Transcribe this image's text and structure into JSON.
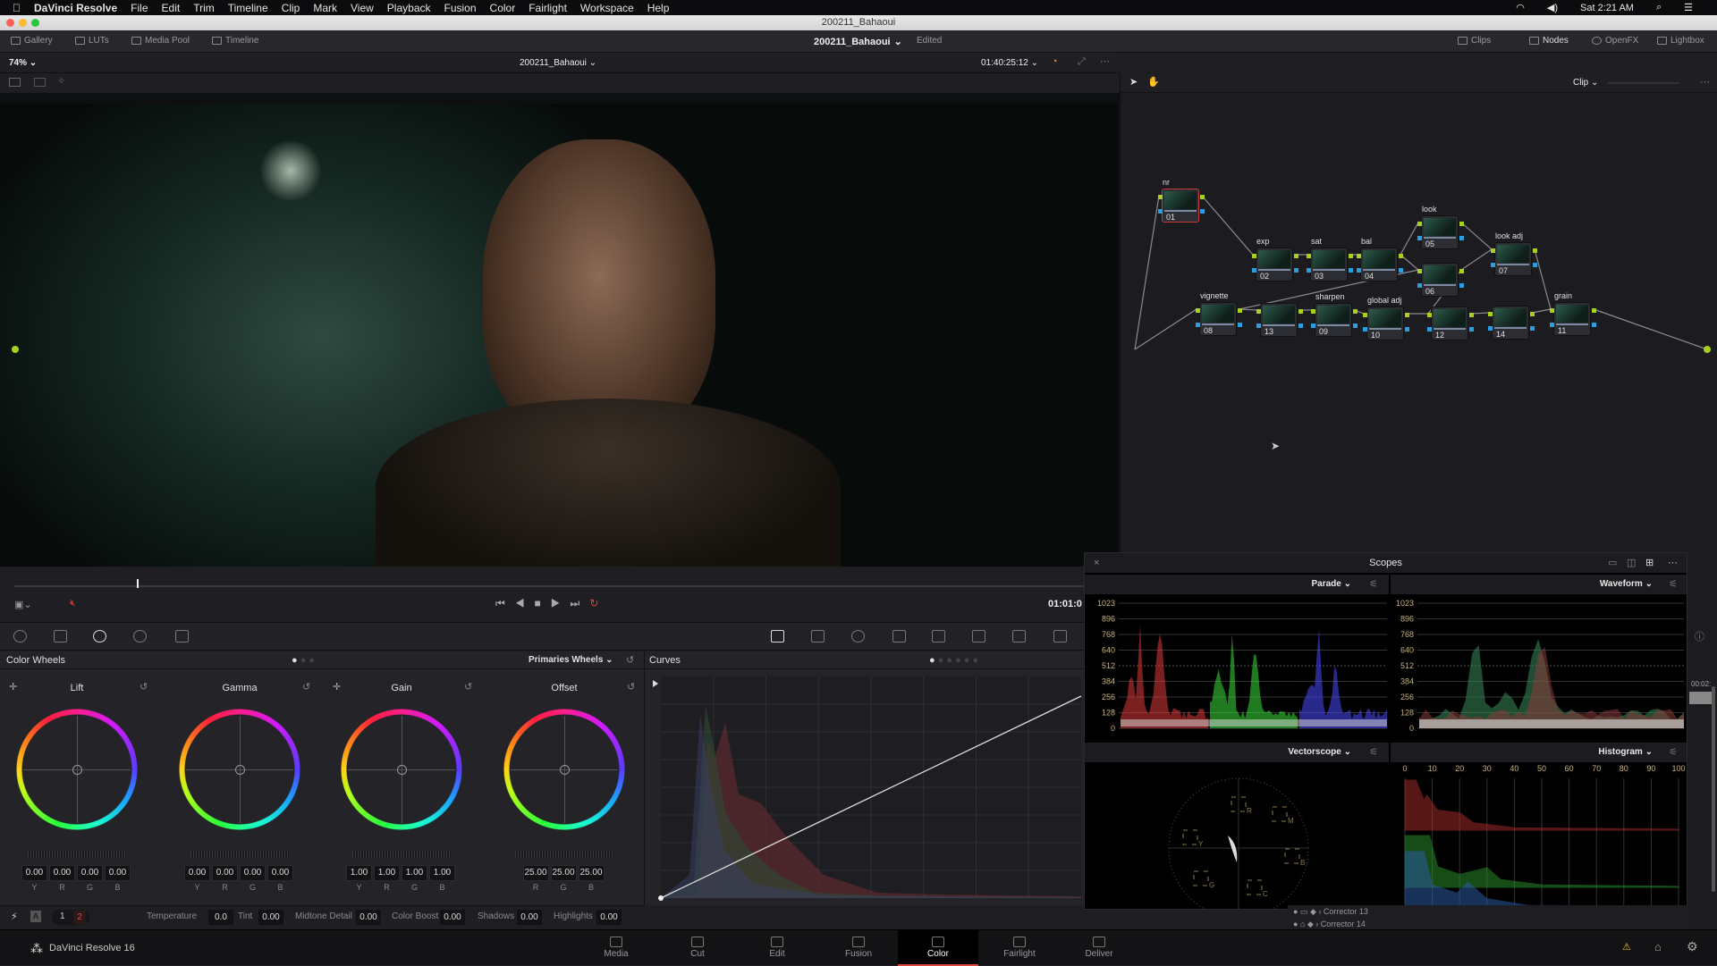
{
  "menubar": {
    "app": "DaVinci Resolve",
    "items": [
      "File",
      "Edit",
      "Trim",
      "Timeline",
      "Clip",
      "Mark",
      "View",
      "Playback",
      "Fusion",
      "Color",
      "Fairlight",
      "Workspace",
      "Help"
    ],
    "clock": "Sat 2:21 AM"
  },
  "window": {
    "title": "200211_Bahaoui"
  },
  "toolbar": {
    "left": [
      "Gallery",
      "LUTs",
      "Media Pool",
      "Timeline"
    ],
    "project": "200211_Bahaoui",
    "status": "Edited",
    "right": [
      "Clips",
      "Nodes",
      "OpenFX",
      "Lightbox"
    ]
  },
  "viewer": {
    "zoom": "74%",
    "clip": "200211_Bahaoui",
    "timecode": "01:40:25:12",
    "node_mode": "Clip",
    "playhead_timecode": "01:01:0"
  },
  "nodes": [
    {
      "label": "nr",
      "num": "01"
    },
    {
      "label": "exp",
      "num": "02"
    },
    {
      "label": "sat",
      "num": "03"
    },
    {
      "label": "bal",
      "num": "04"
    },
    {
      "label": "look",
      "num": "05"
    },
    {
      "label": "",
      "num": "06"
    },
    {
      "label": "look adj",
      "num": "07"
    },
    {
      "label": "vignette",
      "num": "08"
    },
    {
      "label": "",
      "num": "13"
    },
    {
      "label": "sharpen",
      "num": "09"
    },
    {
      "label": "global adj",
      "num": "10"
    },
    {
      "label": "",
      "num": "12"
    },
    {
      "label": "",
      "num": "14"
    },
    {
      "label": "grain",
      "num": "11"
    }
  ],
  "color_wheels": {
    "title": "Color Wheels",
    "mode": "Primaries Wheels",
    "wheels": [
      {
        "name": "Lift",
        "values": [
          "0.00",
          "0.00",
          "0.00",
          "0.00"
        ],
        "channels": [
          "Y",
          "R",
          "G",
          "B"
        ]
      },
      {
        "name": "Gamma",
        "values": [
          "0.00",
          "0.00",
          "0.00",
          "0.00"
        ],
        "channels": [
          "Y",
          "R",
          "G",
          "B"
        ]
      },
      {
        "name": "Gain",
        "values": [
          "1.00",
          "1.00",
          "1.00",
          "1.00"
        ],
        "channels": [
          "Y",
          "R",
          "G",
          "B"
        ]
      },
      {
        "name": "Offset",
        "values": [
          "25.00",
          "25.00",
          "25.00"
        ],
        "channels": [
          "R",
          "G",
          "B"
        ]
      }
    ]
  },
  "adjustments": {
    "pages": [
      "1",
      "2"
    ],
    "auto_label": "A",
    "items": [
      {
        "label": "Temperature",
        "value": "0.0"
      },
      {
        "label": "Tint",
        "value": "0.00"
      },
      {
        "label": "Midtone Detail",
        "value": "0.00"
      },
      {
        "label": "Color Boost",
        "value": "0.00"
      },
      {
        "label": "Shadows",
        "value": "0.00"
      },
      {
        "label": "Highlights",
        "value": "0.00"
      }
    ]
  },
  "curves": {
    "title": "Curves"
  },
  "scopes": {
    "title": "Scopes",
    "parade": "Parade",
    "waveform": "Waveform",
    "vectorscope": "Vectorscope",
    "histogram": "Histogram",
    "y_ticks": [
      "1023",
      "896",
      "768",
      "640",
      "512",
      "384",
      "256",
      "128",
      "0"
    ],
    "hist_ticks": [
      "0",
      "10",
      "20",
      "30",
      "40",
      "50",
      "60",
      "70",
      "80",
      "90",
      "100"
    ],
    "vector_targets": [
      "R",
      "M",
      "B",
      "C",
      "G",
      "Y"
    ]
  },
  "layers": [
    "Corrector 13",
    "Corrector 14"
  ],
  "side_timecode": "00:02:",
  "nav": {
    "app": "DaVinci Resolve 16",
    "pages": [
      "Media",
      "Cut",
      "Edit",
      "Fusion",
      "Color",
      "Fairlight",
      "Deliver"
    ],
    "active": "Color"
  },
  "colors": {
    "accent": "#e0463c",
    "selected_node": "#c83a3a",
    "pin_green": "#a6d21e",
    "pin_blue": "#2a9fe0"
  }
}
